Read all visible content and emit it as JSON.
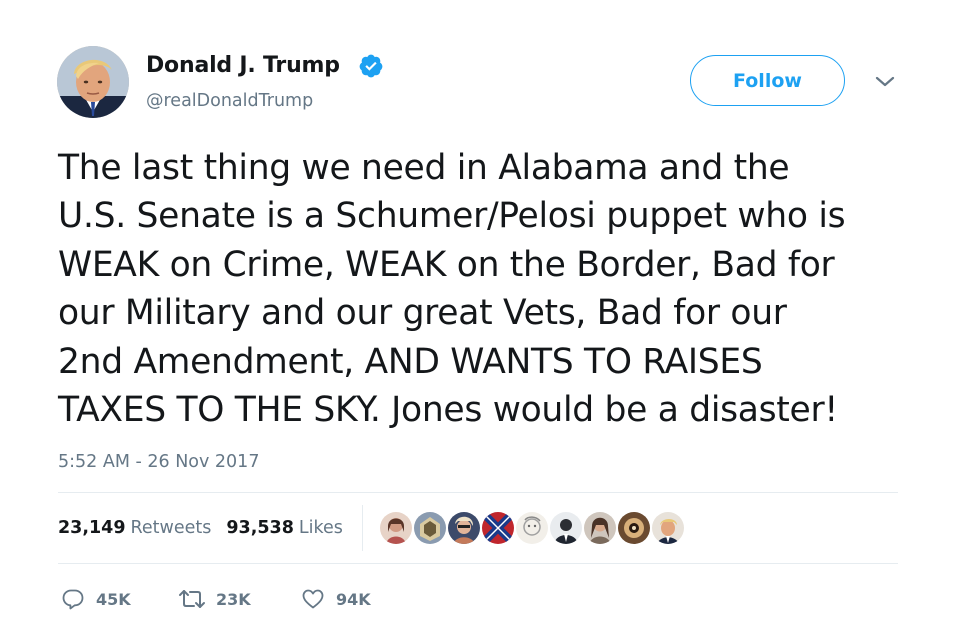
{
  "author": {
    "name": "Donald J. Trump",
    "handle": "@realDonaldTrump",
    "verified": true,
    "avatar_icon": "profile-photo"
  },
  "header": {
    "follow_label": "Follow",
    "menu_icon": "chevron-down-icon"
  },
  "tweet": {
    "lines": [
      "The last thing we need in Alabama and the",
      "U.S. Senate is a Schumer/Pelosi puppet who is",
      "WEAK on Crime, WEAK on the Border, Bad for",
      "our Military and our great Vets, Bad for our",
      "2nd Amendment, AND WANTS TO RAISES",
      "TAXES TO THE SKY. Jones would be a disaster!"
    ],
    "timestamp": "5:52 AM - 26 Nov 2017"
  },
  "stats": {
    "retweets_count": "23,149",
    "retweets_label": "Retweets",
    "likes_count": "93,538",
    "likes_label": "Likes"
  },
  "likers": [
    {
      "name": "liker-1",
      "color": "#b5534f"
    },
    {
      "name": "liker-2",
      "color": "#8a9bb0"
    },
    {
      "name": "liker-3",
      "color": "#c47a5a"
    },
    {
      "name": "liker-4",
      "color": "#1a3a8a"
    },
    {
      "name": "liker-5",
      "color": "#d8d0c8"
    },
    {
      "name": "liker-6",
      "color": "#1f2530"
    },
    {
      "name": "liker-7",
      "color": "#7a6a5c"
    },
    {
      "name": "liker-8",
      "color": "#6a4a30"
    },
    {
      "name": "liker-9",
      "color": "#e8e2da"
    }
  ],
  "actions": {
    "replies": "45K",
    "retweets": "23K",
    "likes": "94K"
  },
  "colors": {
    "accent": "#1da1f2",
    "text": "#14171a",
    "muted": "#657786",
    "divider": "#e6ecf0"
  }
}
